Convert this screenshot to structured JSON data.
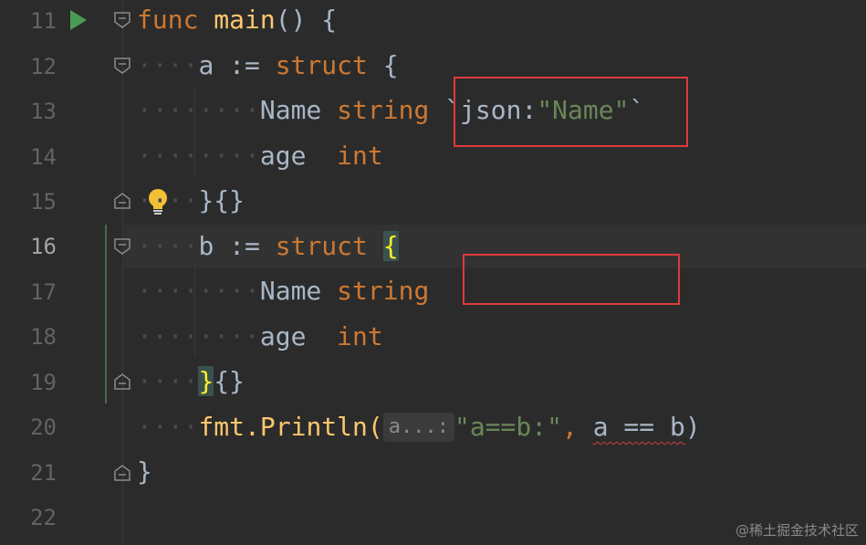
{
  "gutter": {
    "line_numbers": [
      "11",
      "12",
      "13",
      "14",
      "15",
      "16",
      "17",
      "18",
      "19",
      "20",
      "21",
      "22"
    ],
    "current_line": "16"
  },
  "code": {
    "l11": {
      "kw": "func",
      "name": "main",
      "rest": "() {"
    },
    "l12": {
      "ident": "a := ",
      "kw": "struct",
      "rest": " {"
    },
    "l13": {
      "field": "Name ",
      "type": "string",
      "tag_open": "`json:",
      "tag_val": "\"Name\"",
      "tag_close": "`"
    },
    "l14": {
      "field": "age  ",
      "type": "int"
    },
    "l15": {
      "text": "}{}"
    },
    "l16": {
      "ident": "b := ",
      "kw": "struct",
      "space": " ",
      "brace": "{"
    },
    "l17": {
      "field": "Name ",
      "type": "string"
    },
    "l18": {
      "field": "age  ",
      "type": "int"
    },
    "l19": {
      "brace": "}",
      "rest": "{}"
    },
    "l20": {
      "call": "fmt.Println(",
      "hint": "a...:",
      "str": "\"a==b:\"",
      "comma": ", ",
      "expr": "a == b",
      "close": ")"
    },
    "l21": {
      "text": "}"
    }
  },
  "icons": {
    "run": "run-gutter-icon",
    "bulb": "intention-bulb-icon",
    "fold": "fold-marker-icon"
  },
  "watermark": "@稀土掘金技术社区",
  "colors": {
    "background": "#2b2b2b",
    "keyword": "#cc7832",
    "function": "#ffc66d",
    "string": "#6a8759",
    "annotation_box": "#e03a3a",
    "run_icon": "#499c54",
    "bulb": "#f2c037"
  }
}
